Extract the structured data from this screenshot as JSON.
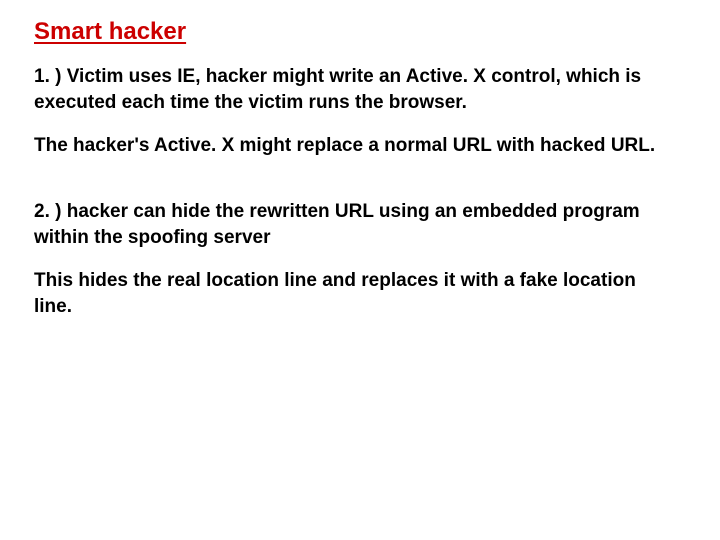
{
  "title": "Smart hacker",
  "p1": "1. ) Victim uses IE, hacker  might write an Active. X control, which is executed each time the victim runs the browser.",
  "p2": "The hacker's Active. X might replace a normal URL with hacked URL.",
  "p3": "2. ) hacker can hide the rewritten URL using an embedded program within the spoofing server",
  "p4": "This hides the real location line and replaces it with a fake location line."
}
